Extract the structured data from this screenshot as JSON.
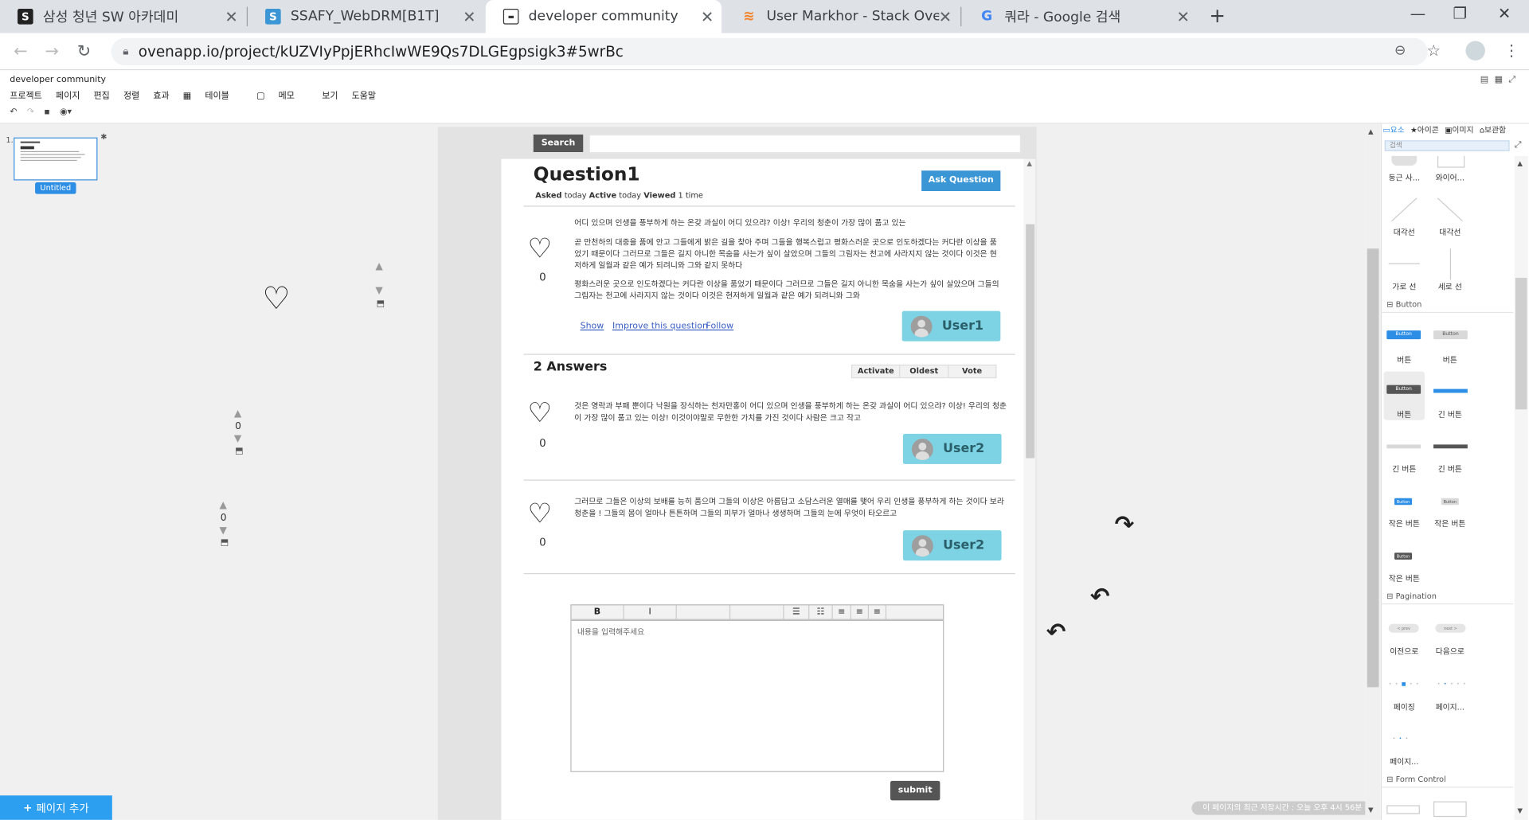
{
  "browser": {
    "tabs": [
      {
        "title": "삼성 청년 SW 아카데미"
      },
      {
        "title": "SSAFY_WebDRM[B1T]"
      },
      {
        "title": "developer community"
      },
      {
        "title": "User Markhor - Stack Overflow"
      },
      {
        "title": "쿼라 - Google 검색"
      }
    ],
    "url": "ovenapp.io/project/kUZVIyPpjERhcIwWE9Qs7DLGEgpsigk3#5wrBc"
  },
  "app": {
    "title": "developer community",
    "menu": [
      "프로젝트",
      "페이지",
      "편집",
      "정렬",
      "효과",
      "테이블",
      "메모",
      "보기",
      "도움말"
    ],
    "page_thumb_number": "1.",
    "page_thumb_label": "Untitled",
    "add_page": "페이지 추가",
    "save_status": "이 페이지의 최근 저장시간 : 오늘 오후 4시 56분"
  },
  "mock": {
    "search_button": "Search",
    "question_title": "Question1",
    "meta": {
      "asked_label": "Asked",
      "asked": "today",
      "active_label": "Active",
      "active": "today",
      "viewed_label": "Viewed",
      "viewed": "1 time"
    },
    "ask_button": "Ask Question",
    "question_paragraphs": [
      "어디 있으며 인생을 풍부하게 하는 온갖 과실이 어디 있으랴? 이상! 우리의 청춘이 가장 많이 품고 있는",
      "곧 만천하의 대중을 품에 안고 그들에게 밝은 길을 찾아 주며 그들을 행복스럽고 평화스러운 곳으로 인도하겠다는 커다란 이상을 품었기 때문이다 그러므로 그들은 길지 아니한 목숨을 사는가 싶이 살았으며 그들의 그림자는 천고에 사라지지 않는 것이다 이것은 현저하게 일월과 같은 예가 되려니와 그와 같지 못하다",
      "평화스러운 곳으로 인도하겠다는 커다란 이상을 품었기 때문이다 그러므로 그들은 길지 아니한 목숨을 사는가 싶이 살았으며 그들의 그림자는 천고에 사라지지 않는 것이다 이것은 현저하게 일월과 같은 예가 되려니와 그와"
    ],
    "question_votes": "0",
    "links": {
      "show": "Show",
      "improve": "Improve this question",
      "follow": "Follow"
    },
    "question_user": "User1",
    "answers_heading": "2 Answers",
    "sort_tabs": [
      "Activate",
      "Oldest",
      "Vote"
    ],
    "answers": [
      {
        "text": "것은 영락과 부패 뿐이다 낙원을 장식하는 천자만홍이 어디 있으며 인생을 풍부하게 하는 온갖 과실이 어디 있으랴? 이상! 우리의 청춘이 가장 많이 품고 있는 이상! 이것이야말로 무한한 가치를 가진 것이다 사람은 크고 작고",
        "votes": "0",
        "user": "User2"
      },
      {
        "text": "그러므로 그들은 이상의 보배를 능히 품으며 그들의 이상은 아름답고 소담스러운 열매를 맺어 우리 인생을 풍부하게 하는 것이다 보라 청춘을 ! 그들의 몸이 얼마나 튼튼하며 그들의 피부가 얼마나 생생하며 그들의 눈에 무엇이 타오르고",
        "votes": "0",
        "user": "User2"
      }
    ],
    "editor_toolbar": {
      "bold": "B",
      "italic": "I"
    },
    "editor_placeholder": "내용을 입력해주세요",
    "submit": "submit",
    "floating_counts": [
      "0",
      "0"
    ]
  },
  "right_panel": {
    "tabs": [
      "요소",
      "아이콘",
      "이미지",
      "보관함"
    ],
    "search_placeholder": "검색",
    "top_labels": [
      "둥근 사...",
      "와이어..."
    ],
    "line_labels": [
      "대각선",
      "대각선",
      "가로 선",
      "세로 선"
    ],
    "sections": [
      "Button",
      "Pagination",
      "Form Control"
    ],
    "button_items": [
      {
        "label": "버튼",
        "mini": "Button",
        "color": "#2d8ee6"
      },
      {
        "label": "버튼",
        "mini": "Button",
        "color": "#d9d9d9"
      },
      {
        "label": "버튼",
        "mini": "Button",
        "color": "#555555"
      },
      {
        "label": "긴 버튼",
        "mini": "",
        "color": "#2d8ee6"
      },
      {
        "label": "긴 버튼",
        "mini": "",
        "color": "#d9d9d9"
      },
      {
        "label": "긴 버튼",
        "mini": "",
        "color": "#555555"
      },
      {
        "label": "작은 버튼",
        "mini": "Button",
        "color": "#2d8ee6"
      },
      {
        "label": "작은 버튼",
        "mini": "Button",
        "color": "#d9d9d9"
      },
      {
        "label": "작은 버튼",
        "mini": "Button",
        "color": "#555555"
      }
    ],
    "pagination_items": [
      {
        "label": "이전으로",
        "mini": "< prev"
      },
      {
        "label": "다음으로",
        "mini": "next >"
      },
      {
        "label": "페이징"
      },
      {
        "label": "페이지..."
      },
      {
        "label": "페이지..."
      }
    ]
  }
}
